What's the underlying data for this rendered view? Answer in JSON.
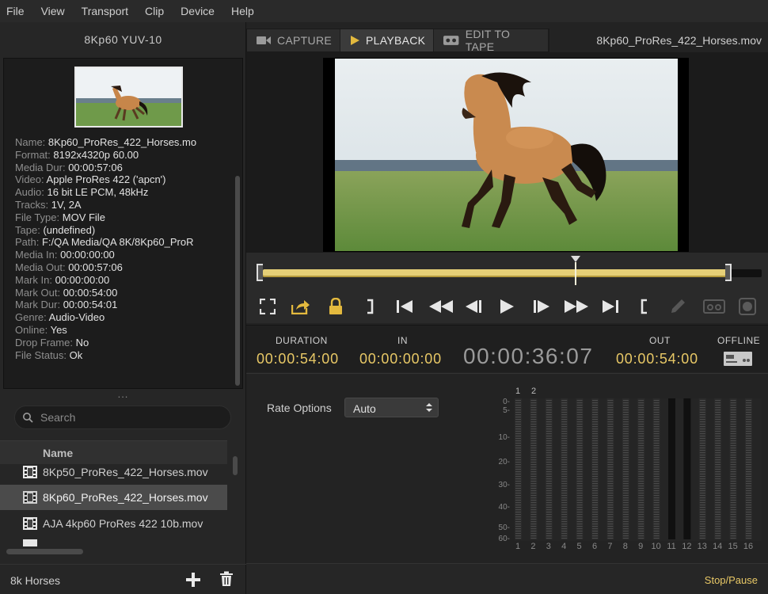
{
  "menu": [
    "File",
    "View",
    "Transport",
    "Clip",
    "Device",
    "Help"
  ],
  "left": {
    "format": "8Kp60  YUV-10",
    "info": [
      {
        "k": "Name:",
        "v": "8Kp60_ProRes_422_Horses.mo"
      },
      {
        "k": "Format:",
        "v": "8192x4320p 60.00"
      },
      {
        "k": "Media Dur:",
        "v": "00:00:57:06"
      },
      {
        "k": "Video:",
        "v": "Apple ProRes 422 ('apcn')"
      },
      {
        "k": "Audio:",
        "v": "16 bit LE PCM, 48kHz"
      },
      {
        "k": "Tracks:",
        "v": "1V, 2A"
      },
      {
        "k": "File Type:",
        "v": "MOV File"
      },
      {
        "k": "Tape:",
        "v": "(undefined)"
      },
      {
        "k": "Path:",
        "v": "F:/QA Media/QA 8K/8Kp60_ProR"
      },
      {
        "k": "Media In:",
        "v": "00:00:00:00"
      },
      {
        "k": "Media Out:",
        "v": "00:00:57:06"
      },
      {
        "k": "Mark In:",
        "v": "00:00:00:00"
      },
      {
        "k": "Mark Out:",
        "v": "00:00:54:00"
      },
      {
        "k": "Mark Dur:",
        "v": "00:00:54:01"
      },
      {
        "k": "Genre:",
        "v": "Audio-Video"
      },
      {
        "k": "Online:",
        "v": "Yes"
      },
      {
        "k": "Drop Frame:",
        "v": "No"
      },
      {
        "k": "File Status:",
        "v": "Ok"
      }
    ],
    "dots": "...",
    "search_placeholder": "Search",
    "list_header": "Name",
    "files": [
      {
        "name": "8Kp50_ProRes_422_Horses.mov",
        "selected": false
      },
      {
        "name": "8Kp60_ProRes_422_Horses.mov",
        "selected": true
      },
      {
        "name": "AJA 4kp60 ProRes 422 10b.mov",
        "selected": false
      }
    ],
    "bin_label": "8k Horses"
  },
  "tabs": [
    {
      "label": "CAPTURE",
      "icon": "camera-icon"
    },
    {
      "label": "PLAYBACK",
      "icon": "play-icon"
    },
    {
      "label": "EDIT TO TAPE",
      "icon": "tape-icon"
    }
  ],
  "clip_name": "8Kp60_ProRes_422_Horses.mov",
  "scrub_position": 0.67,
  "timecodes": {
    "duration_label": "DURATION",
    "duration": "00:00:54:00",
    "in_label": "IN",
    "in": "00:00:00:00",
    "current": "00:00:36:07",
    "out_label": "OUT",
    "out": "00:00:54:00",
    "offline_label": "OFFLINE"
  },
  "rate": {
    "label": "Rate Options",
    "value": "Auto"
  },
  "meter": {
    "active_channels": [
      "1",
      "2"
    ],
    "scale": [
      "0-",
      "5-",
      "10-",
      "20-",
      "30-",
      "40-",
      "50-",
      "60-"
    ],
    "channels": [
      "1",
      "2",
      "3",
      "4",
      "5",
      "6",
      "7",
      "8",
      "9",
      "10",
      "11",
      "12",
      "13",
      "14",
      "15",
      "16"
    ]
  },
  "status": "Stop/Pause",
  "colors": {
    "accent": "#e8c866",
    "track": "#e5cf77"
  }
}
